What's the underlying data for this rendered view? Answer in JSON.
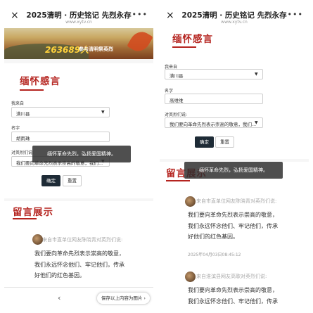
{
  "header": {
    "title": "2025清明 · 历史铭记 先烈永存",
    "url": "www.xytv.cn",
    "close_icon": "×",
    "more_icon": "•••"
  },
  "banner": {
    "count": "263689人",
    "text": "参与清明祭英烈"
  },
  "form": {
    "section_title": "缅怀感言",
    "from_label": "我来自",
    "from_value": "潢川县",
    "name_label": "名字",
    "name_value_left": "胡雨珠",
    "name_value_right": "高维维",
    "say_label": "对英烈们说:",
    "say_value": "我们要向革命先烈表示崇高的敬意，我们...",
    "ok_label": "确定",
    "reset_label": "重置"
  },
  "toast": {
    "text": "缅怀革命先烈，弘扬爱国精神。"
  },
  "messages": {
    "section_title": "留言展示",
    "items": [
      {
        "from": "来自市直单位网友陈晓青对英烈们说:",
        "line1": "我们要向革命先烈表示崇高的敬意，",
        "line2": "我们永远怀念他们、牢记他们，传承",
        "line3": "好他们的红色基因。",
        "time": "2025年04月03日08:45:12"
      },
      {
        "from": "来自淮滨县网友高歌对英烈们说:",
        "line1": "我们要向革命先烈表示崇高的敬意，",
        "line2": "我们永远怀念他们、牢记他们，传承"
      }
    ]
  },
  "bottom": {
    "back_icon": "‹",
    "forward_icon": "›",
    "save_label": "保存以上内容为图片 ›"
  },
  "colors": {
    "accent": "#b5241f",
    "button_dark": "#1e2b36"
  }
}
